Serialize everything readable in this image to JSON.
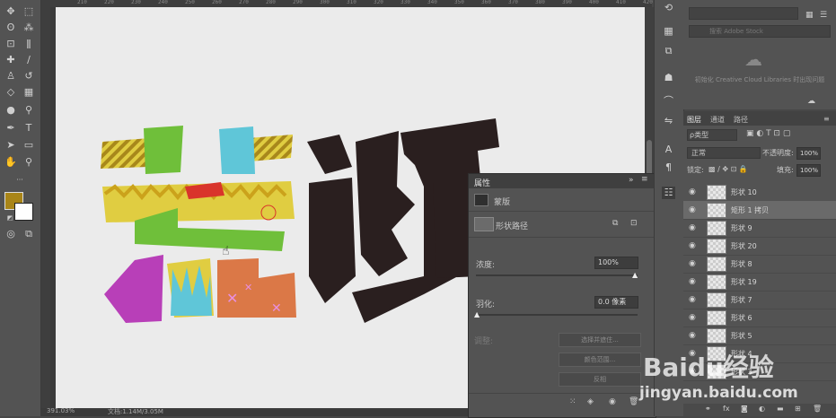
{
  "ruler": {
    "ticks": [
      "210",
      "220",
      "230",
      "240",
      "250",
      "260",
      "270",
      "280",
      "290",
      "300",
      "310",
      "320",
      "330",
      "340",
      "350",
      "360",
      "370",
      "380",
      "390",
      "400",
      "410",
      "420"
    ]
  },
  "status": {
    "zoom": "391.03%",
    "doc": "文档:1.14M/3.05M"
  },
  "artwork": {
    "chars": "诞",
    "colors": {
      "green": "#6fbf3a",
      "cyan": "#5fc6d8",
      "yellow": "#e0cd41",
      "red": "#d9342b",
      "purple": "#b83fb8",
      "orange": "#db7847",
      "dark": "#2a1f1f"
    }
  },
  "library": {
    "search_placeholder": "搜索 Adobe Stock",
    "message": "初始化 Creative Cloud Libraries 时出现问题"
  },
  "layers_panel": {
    "tabs": [
      "图层",
      "通道",
      "路径"
    ],
    "filter_label": "ρ类型",
    "blend_mode": "正常",
    "opacity_label": "不透明度:",
    "opacity_value": "100%",
    "lock_label": "锁定:",
    "fill_label": "填充:",
    "fill_value": "100%",
    "layers": [
      {
        "name": "形状 10"
      },
      {
        "name": "矩形 1 拷贝"
      },
      {
        "name": "形状 9"
      },
      {
        "name": "形状 20"
      },
      {
        "name": "形状 8"
      },
      {
        "name": "形状 19"
      },
      {
        "name": "形状 7"
      },
      {
        "name": "形状 6"
      },
      {
        "name": "形状 5"
      },
      {
        "name": "形状 4"
      },
      {
        "name": "形状 3"
      }
    ]
  },
  "properties": {
    "title": "属性",
    "mask_label": "蒙版",
    "shape_path_label": "形状路径",
    "density_label": "浓度:",
    "density_value": "100%",
    "feather_label": "羽化:",
    "feather_value": "0.0 像素",
    "adjust_label": "调整:",
    "btn_select": "选择并遮住...",
    "btn_color": "颜色范围...",
    "btn_invert": "反相"
  },
  "watermark": {
    "brand": "Baidu经验",
    "url": "jingyan.baidu.com"
  }
}
